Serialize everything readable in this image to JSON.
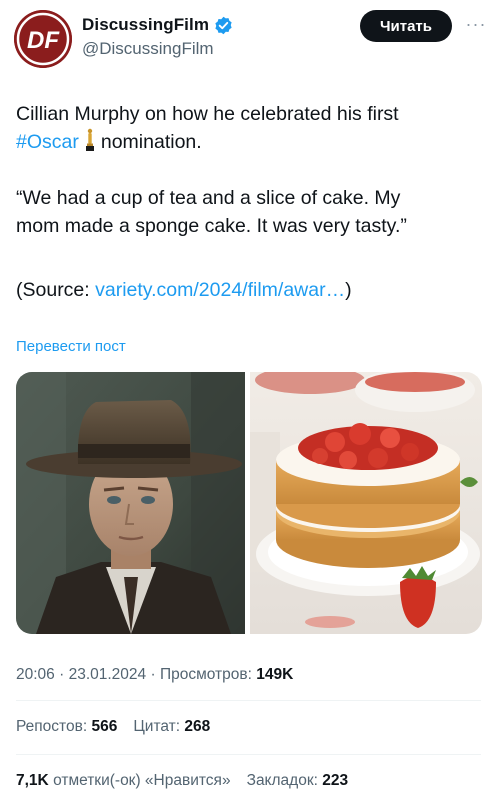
{
  "author": {
    "display_name": "DiscussingFilm",
    "handle": "@DiscussingFilm",
    "avatar_letters": "DF",
    "avatar_color": "#8b1d1d",
    "verified": true
  },
  "actions": {
    "follow_label": "Читать",
    "more_label": "···"
  },
  "tweet": {
    "line1": "Cillian Murphy on how he celebrated his first",
    "hashtag": "#Oscar",
    "line2_rest": "nomination.",
    "quote_line1": "“We had a cup of tea and a slice of cake. My",
    "quote_line2": "mom made a sponge cake. It was very tasty.”",
    "source_prefix": "(Source: ",
    "source_link": "variety.com/2024/film/awar…",
    "source_suffix": ")"
  },
  "translate_label": "Перевести пост",
  "media": [
    {
      "name": "cillian-murphy-photo",
      "icon": "photo"
    },
    {
      "name": "sponge-cake-photo",
      "icon": "photo"
    }
  ],
  "meta": {
    "time": "20:06",
    "sep": " · ",
    "date": "23.01.2024",
    "views_label": "Просмотров:",
    "views_value": "149K"
  },
  "stats": {
    "reposts_label": "Репостов:",
    "reposts_value": "566",
    "quotes_label": "Цитат:",
    "quotes_value": "268",
    "likes_value": "7,1K",
    "likes_label": "отметки(-ок) «Нравится»",
    "bookmarks_label": "Закладок:",
    "bookmarks_value": "223"
  },
  "colors": {
    "link": "#1d9bf0",
    "text": "#0f1419",
    "secondary": "#536471",
    "button_bg": "#0f1419"
  }
}
